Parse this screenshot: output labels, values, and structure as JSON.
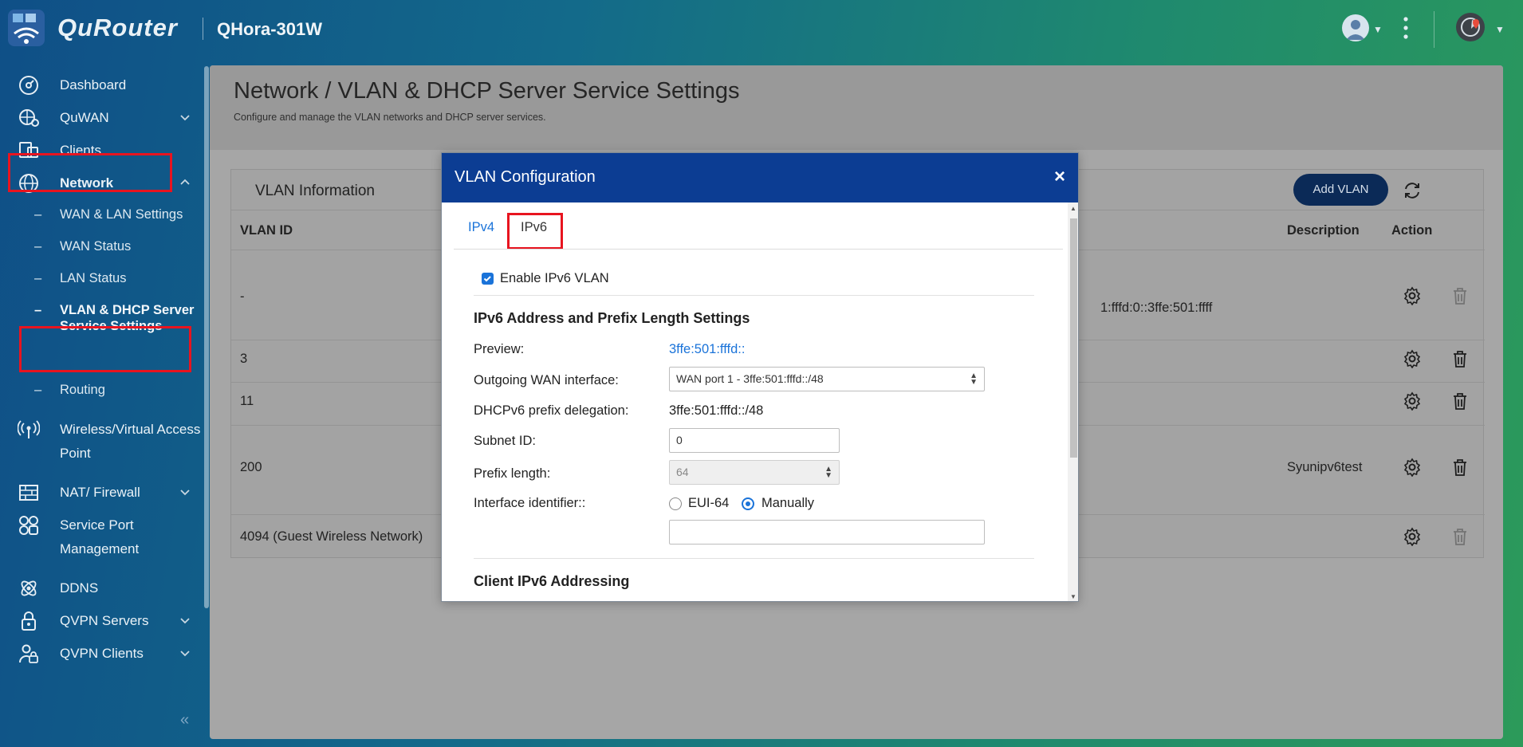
{
  "header": {
    "brand": "QuRouter",
    "model": "QHora-301W"
  },
  "sidebar": {
    "items": [
      {
        "label": "Dashboard"
      },
      {
        "label": "QuWAN"
      },
      {
        "label": "Clients"
      },
      {
        "label": "Network"
      },
      {
        "label": "Wireless/Virtual Access",
        "label2": "Point"
      },
      {
        "label": "NAT/ Firewall"
      },
      {
        "label": "Service Port",
        "label2": "Management"
      },
      {
        "label": "DDNS"
      },
      {
        "label": "QVPN Servers"
      },
      {
        "label": "QVPN Clients"
      }
    ],
    "network_sub": [
      {
        "label": "WAN & LAN Settings"
      },
      {
        "label": "WAN Status"
      },
      {
        "label": "LAN Status"
      },
      {
        "label": "VLAN & DHCP Server",
        "label2": "Service Settings"
      },
      {
        "label": "Routing"
      }
    ]
  },
  "page": {
    "title": "Network / VLAN & DHCP Server Service Settings",
    "subtitle": "Configure and manage the VLAN networks and DHCP server services."
  },
  "vlan_card": {
    "title": "VLAN Information",
    "add_button": "Add VLAN",
    "columns": {
      "vlan_id": "VLAN ID",
      "description": "Description",
      "action": "Action"
    },
    "rows": [
      {
        "vlan_id": "-",
        "partial": "1:fffd:0::3ffe:501:ffff",
        "description": ""
      },
      {
        "vlan_id": "3",
        "partial": "",
        "description": ""
      },
      {
        "vlan_id": "11",
        "partial": "",
        "description": ""
      },
      {
        "vlan_id": "200",
        "partial": "",
        "description": "Syunipv6test"
      },
      {
        "vlan_id": "4094 (Guest Wireless Network)",
        "partial": "",
        "description": ""
      }
    ]
  },
  "modal": {
    "title": "VLAN Configuration",
    "close": "×",
    "tabs": [
      "IPv4",
      "IPv6"
    ],
    "active_tab": "IPv6",
    "enable_label": "Enable IPv6 VLAN",
    "enable_checked": true,
    "section1": "IPv6 Address and Prefix Length Settings",
    "preview_label": "Preview:",
    "preview_value": "3ffe:501:fffd::",
    "wan_label": "Outgoing WAN interface:",
    "wan_value": "WAN port 1 - 3ffe:501:fffd::/48",
    "pd_label": "DHCPv6 prefix delegation:",
    "pd_value": "3ffe:501:fffd::/48",
    "subnet_label": "Subnet ID:",
    "subnet_value": "0",
    "prefix_label": "Prefix length:",
    "prefix_value": "64",
    "ifid_label": "Interface identifier::",
    "ifid_opt1": "EUI-64",
    "ifid_opt2": "Manually",
    "ifid_selected": "Manually",
    "ifid_value": "",
    "section2": "Client IPv6 Addressing"
  },
  "colors": {
    "accent": "#1a73d9",
    "modal_header": "#0c3d93",
    "highlight": "#e8141f",
    "add_button": "#0b2a57"
  }
}
